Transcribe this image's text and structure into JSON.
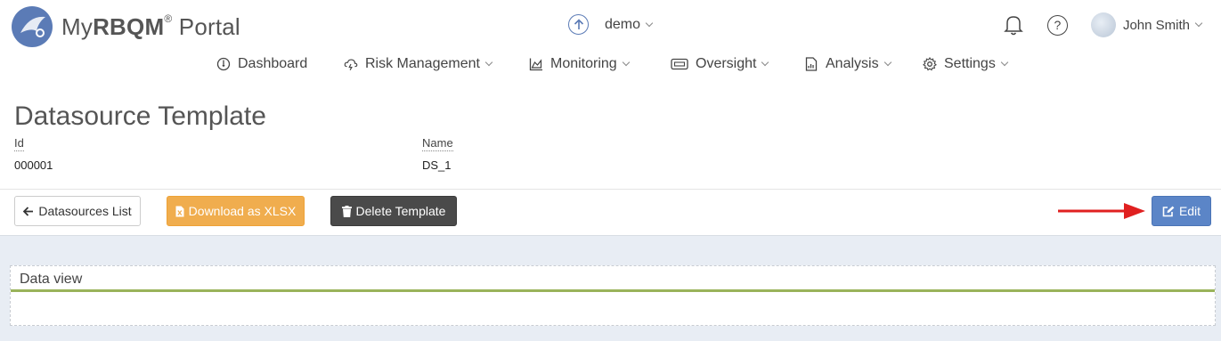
{
  "app": {
    "brand_prefix": "My",
    "brand_bold": "RBQM",
    "brand_reg": "®",
    "brand_suffix": " Portal"
  },
  "header": {
    "study_name": "demo",
    "user_name": "John Smith"
  },
  "nav": {
    "items": [
      {
        "label": "Dashboard",
        "icon": "dashboard-icon"
      },
      {
        "label": "Risk Management",
        "icon": "risk-cloud-icon"
      },
      {
        "label": "Monitoring",
        "icon": "area-chart-icon"
      },
      {
        "label": "Oversight",
        "icon": "oversight-icon"
      },
      {
        "label": "Analysis",
        "icon": "document-chart-icon"
      },
      {
        "label": "Settings",
        "icon": "gear-icon"
      }
    ]
  },
  "page": {
    "title": "Datasource Template",
    "id_label": "Id",
    "id_value": "000001",
    "name_label": "Name",
    "name_value": "DS_1"
  },
  "toolbar": {
    "back_label": "Datasources List",
    "download_label": "Download as XLSX",
    "delete_label": "Delete Template",
    "edit_label": "Edit"
  },
  "panel": {
    "title": "Data view"
  },
  "colors": {
    "brand": "#5b7bb6",
    "download": "#f0ad4e",
    "delete": "#4a4a4a",
    "edit": "#5b85c7",
    "panel_accent": "#9ab35a",
    "annotation_arrow": "#e02020"
  }
}
